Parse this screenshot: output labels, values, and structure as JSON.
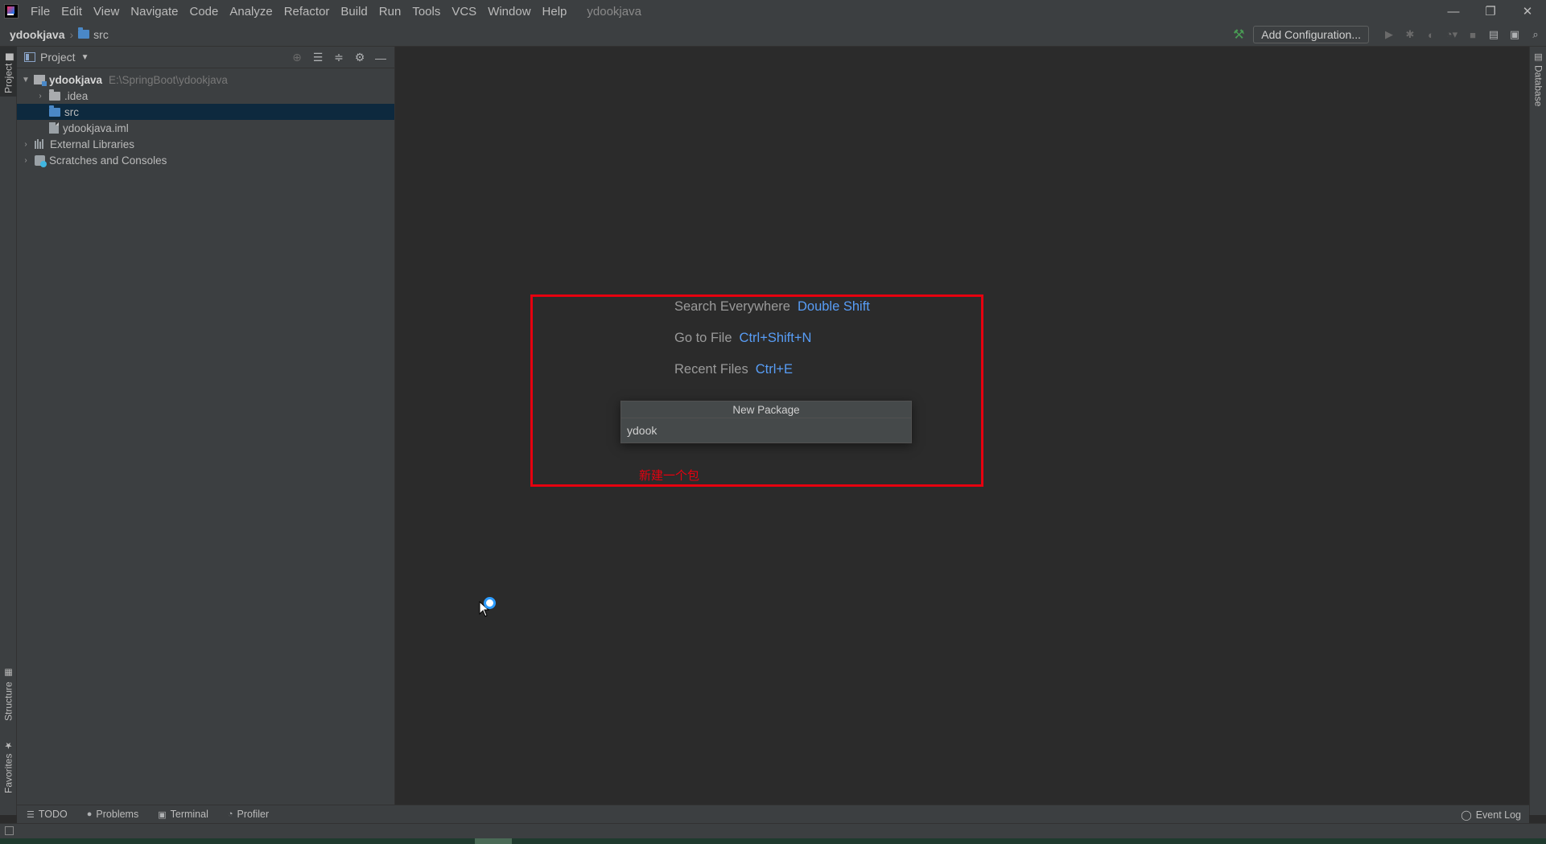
{
  "menubar": {
    "items": [
      "File",
      "Edit",
      "View",
      "Navigate",
      "Code",
      "Analyze",
      "Refactor",
      "Build",
      "Run",
      "Tools",
      "VCS",
      "Window",
      "Help"
    ],
    "window_title": "ydookjava",
    "minimize": "—",
    "restore": "❐",
    "close": "✕"
  },
  "navbar": {
    "project": "ydookjava",
    "folder": "src",
    "add_configuration": "Add Configuration..."
  },
  "project_panel": {
    "title": "Project",
    "tree": {
      "root_name": "ydookjava",
      "root_path": "E:\\SpringBoot\\ydookjava",
      "idea": ".idea",
      "src": "src",
      "iml": "ydookjava.iml",
      "libraries": "External Libraries",
      "scratches": "Scratches and Consoles"
    }
  },
  "left_stripe": {
    "project": "Project",
    "structure": "Structure",
    "favorites": "Favorites"
  },
  "right_stripe": {
    "database": "Database"
  },
  "editor": {
    "hints": [
      {
        "label": "Search Everywhere",
        "key": "Double Shift"
      },
      {
        "label": "Go to File",
        "key": "Ctrl+Shift+N"
      },
      {
        "label": "Recent Files",
        "key": "Ctrl+E"
      }
    ],
    "annotation": "新建一个包"
  },
  "new_package_popup": {
    "title": "New Package",
    "value": "ydook"
  },
  "bottom_bar": {
    "todo": "TODO",
    "problems": "Problems",
    "terminal": "Terminal",
    "profiler": "Profiler",
    "event_log": "Event Log"
  },
  "colors": {
    "accent_red": "#e6000f",
    "shortcut_blue": "#589df6",
    "selection": "#0d293e"
  }
}
